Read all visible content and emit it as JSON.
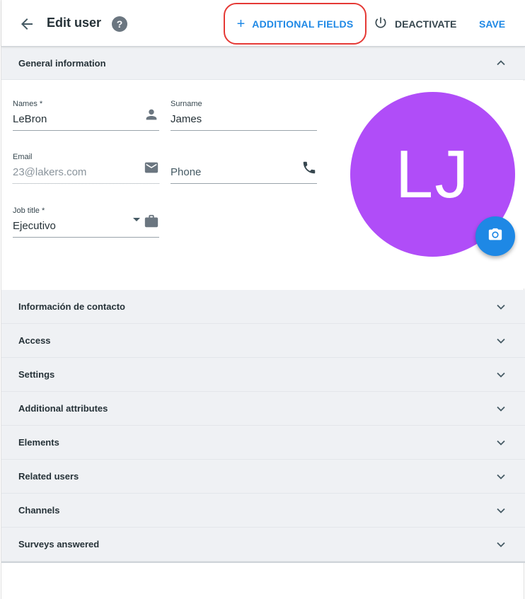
{
  "header": {
    "title": "Edit user",
    "help_symbol": "?",
    "add_fields_plus": "+",
    "add_fields_label": "ADDITIONAL FIELDS",
    "deactivate_label": "DEACTIVATE",
    "save_label": "SAVE"
  },
  "general": {
    "title": "General information",
    "names_label": "Names *",
    "names_value": "LeBron",
    "surname_label": "Surname",
    "surname_value": "James",
    "email_label": "Email",
    "email_value": "23@lakers.com",
    "phone_placeholder": "Phone",
    "job_label": "Job title *",
    "job_value": "Ejecutivo",
    "avatar_initials": "LJ"
  },
  "sections": [
    {
      "label": "Información de contacto"
    },
    {
      "label": "Access"
    },
    {
      "label": "Settings"
    },
    {
      "label": "Additional attributes"
    },
    {
      "label": "Elements"
    },
    {
      "label": "Related users"
    },
    {
      "label": "Channels"
    },
    {
      "label": "Surveys answered"
    }
  ],
  "colors": {
    "accent": "#1e88e5",
    "avatar": "#b04df8",
    "highlight": "#e53935",
    "section_bg": "#eff1f4"
  },
  "icons": {
    "back": "arrow-back-icon",
    "help": "help-icon",
    "power": "power-icon",
    "person": "person-icon",
    "email": "email-icon",
    "phone": "phone-icon",
    "briefcase": "briefcase-icon",
    "camera": "camera-icon",
    "chevron": "chevron-icon"
  }
}
